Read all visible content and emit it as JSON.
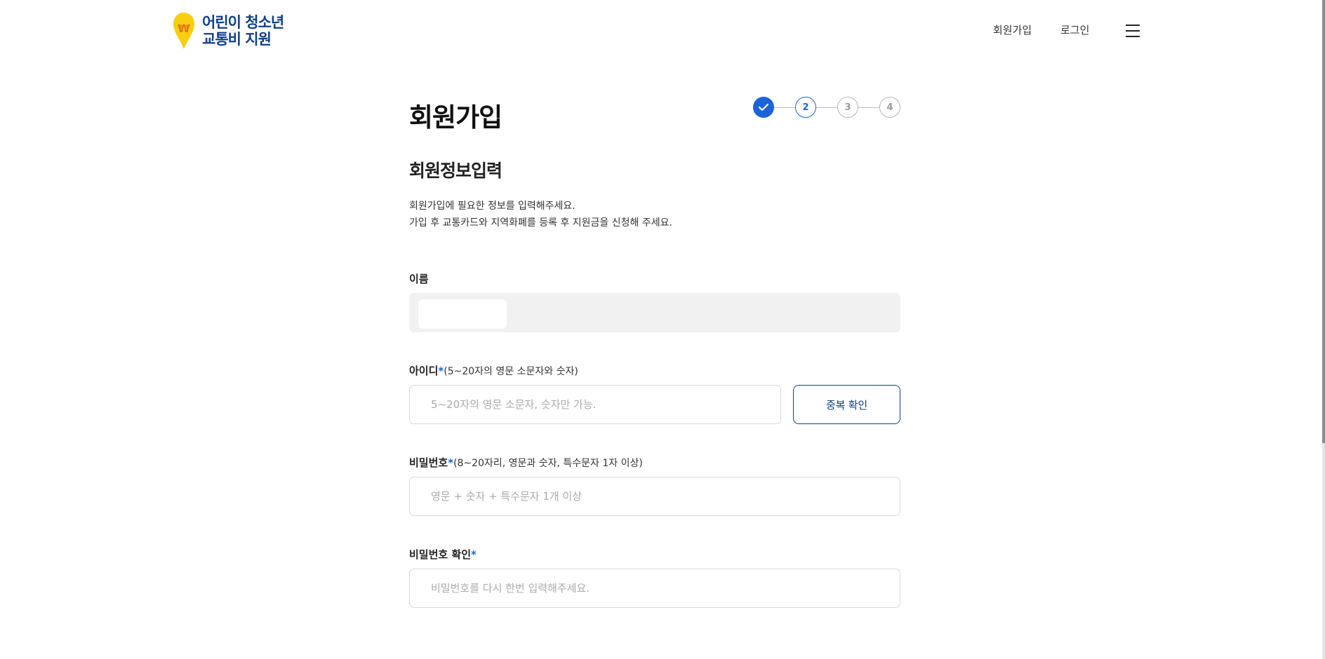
{
  "header": {
    "logo_line1": "어린이 청소년",
    "logo_line2": "교통비 지원",
    "logo_icon": "won-pin-icon",
    "nav_join": "회원가입",
    "nav_login": "로그인",
    "menu_icon": "hamburger-menu-icon"
  },
  "stepper": {
    "steps": [
      {
        "label": "",
        "state": "done",
        "icon": "check-icon"
      },
      {
        "label": "2",
        "state": "current"
      },
      {
        "label": "3",
        "state": "todo"
      },
      {
        "label": "4",
        "state": "todo"
      }
    ],
    "active_color": "#1c63d9"
  },
  "page": {
    "title": "회원가입",
    "section_title": "회원정보입력",
    "desc_line1": "회원가입에 필요한 정보를 입력해주세요.",
    "desc_line2": "가입 후 교통카드와 지역화폐를 등록 후 지원금을 신청해 주세요."
  },
  "form": {
    "name": {
      "label": "이름",
      "value": ""
    },
    "user_id": {
      "label": "아이디",
      "required_mark": "*",
      "hint": "(5~20자의 영문 소문자와 숫자)",
      "placeholder": "5~20자의 영문 소문자, 숫자만 가능.",
      "check_button": "중복 확인"
    },
    "password": {
      "label": "비밀번호",
      "required_mark": "*",
      "hint": "(8~20자리, 영문과 숫자, 특수문자 1자 이상)",
      "placeholder": "영문 + 숫자 + 특수문자 1개 이상"
    },
    "password_confirm": {
      "label": "비밀번호 확인",
      "required_mark": "*",
      "placeholder": "비밀번호를 다시 한번 입력해주세요."
    }
  },
  "colors": {
    "brand_navy": "#123f88",
    "accent_blue": "#1c63d9",
    "logo_yellow": "#f7cf0f"
  }
}
